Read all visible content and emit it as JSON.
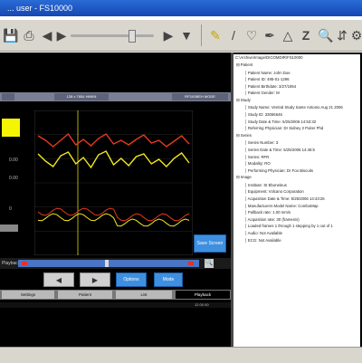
{
  "window": {
    "title": "... user - FS10000"
  },
  "toolbar": {
    "icons": [
      "save-icon",
      "print-icon",
      "back-icon",
      "forward-icon",
      "dropdown-icon",
      "marker-icon",
      "line-icon",
      "heart-icon",
      "pen-icon",
      "triangle-icon",
      "zoom-z-icon",
      "magnifier-icon",
      "split-icon",
      "settings-icon"
    ]
  },
  "viewer": {
    "header_tabs": [
      "",
      "128 x 7654 HMKN",
      "RF3X0BEH MODE"
    ],
    "left_values": [
      "0.00",
      "0.00",
      "0"
    ],
    "save_label": "Save Screen",
    "playback_label": "Playback",
    "options_label": "Options",
    "mode_label": "Mode",
    "tabs": [
      "Settings",
      "Patient",
      "List",
      "Playback"
    ],
    "bottom_text": "12 00 00"
  },
  "chart_data": {
    "type": "line",
    "title": "",
    "series": [
      {
        "name": "",
        "color": "#e63a1f",
        "values": [
          80,
          75,
          68,
          75,
          82,
          70,
          76,
          69,
          77,
          82,
          71,
          75,
          70,
          76,
          81,
          72,
          75,
          68,
          74,
          80,
          71
        ]
      },
      {
        "name": "",
        "color": "#f2e81e",
        "values": [
          60,
          52,
          46,
          58,
          62,
          49,
          56,
          45,
          59,
          63,
          48,
          55,
          47,
          57,
          60,
          49,
          54,
          46,
          55,
          61,
          50
        ]
      }
    ],
    "grid": true,
    "legend": "none"
  },
  "tree": {
    "path": "C:\\Archive\\Image\\DICOMDIR\\FS10000",
    "items": [
      {
        "level": 0,
        "text": "Patient"
      },
      {
        "level": 1,
        "text": "Patient Name: John Doe"
      },
      {
        "level": 1,
        "text": "Patient ID: 495-01-1296"
      },
      {
        "level": 1,
        "text": "Patient Birthdate: 3/27/1954"
      },
      {
        "level": 1,
        "text": "Patient Gender: M"
      },
      {
        "level": 0,
        "text": "Study"
      },
      {
        "level": 1,
        "text": "Study Name: Ventral Study Sante Antonio Aug 21 2006"
      },
      {
        "level": 1,
        "text": "Study ID: 33066645"
      },
      {
        "level": 1,
        "text": "Study Date & Time: 5/25/2006 14:53:32"
      },
      {
        "level": 1,
        "text": "Referring Physician: Dr Sidney 2 Poiter Phd"
      },
      {
        "level": 0,
        "text": "Series"
      },
      {
        "level": 1,
        "text": "Series Number: 3"
      },
      {
        "level": 1,
        "text": "Series Date & Time: 5/25/2006 14:45:5"
      },
      {
        "level": 1,
        "text": "Series: RFR"
      },
      {
        "level": 1,
        "text": "Modality: RO"
      },
      {
        "level": 1,
        "text": "Performing Physician: Dr Foo Biscuits"
      },
      {
        "level": 0,
        "text": "Image"
      },
      {
        "level": 1,
        "text": "Institute: St Eboneleus"
      },
      {
        "level": 1,
        "text": "Equipment: Volcano Corporation"
      },
      {
        "level": 1,
        "text": "Acquisition Date & Time: 5/25/2006 14:43:26"
      },
      {
        "level": 1,
        "text": "Manufacturers Model Name: ComboMap"
      },
      {
        "level": 1,
        "text": "Pullback rate: 1.00 mm/s"
      },
      {
        "level": 1,
        "text": "Acquisition rate: 30 (frames/s)"
      },
      {
        "level": 1,
        "text": "Loaded frames 1 through 1 stepping by 1 out of 1"
      },
      {
        "level": 1,
        "text": "Audio: Not Available"
      },
      {
        "level": 1,
        "text": "ECG: Not Available"
      }
    ]
  }
}
